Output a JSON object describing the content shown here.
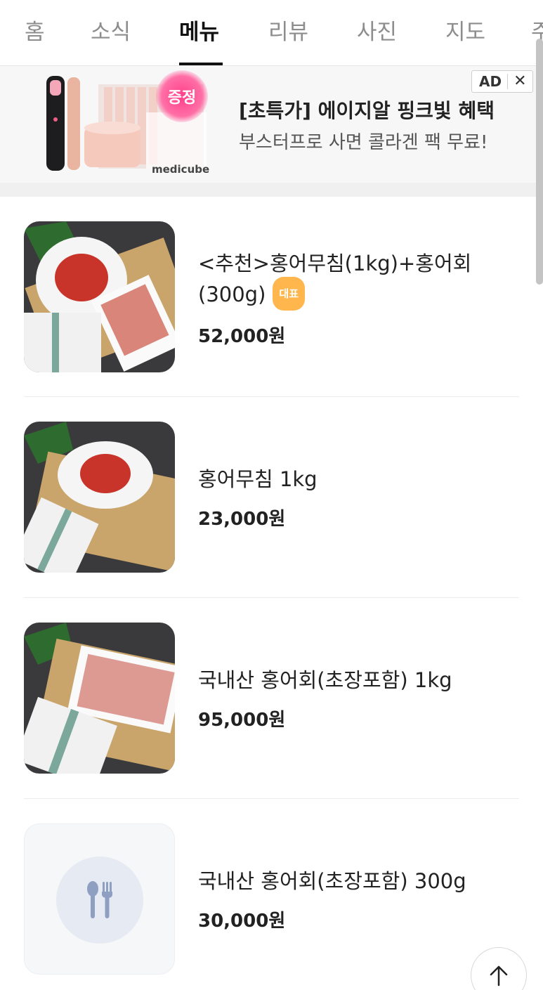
{
  "tabs": [
    {
      "label": "홈"
    },
    {
      "label": "소식"
    },
    {
      "label": "메뉴"
    },
    {
      "label": "리뷰"
    },
    {
      "label": "사진"
    },
    {
      "label": "지도"
    },
    {
      "label": "주"
    }
  ],
  "active_tab": "메뉴",
  "ad": {
    "badge": "AD",
    "close": "✕",
    "title": "[초특가] 에이지알 핑크빛 혜택",
    "subtitle": "부스터프로 사면 콜라겐 팩 무료!",
    "gift_label": "증정",
    "brand": "medicube"
  },
  "menu": {
    "items": [
      {
        "name": "<추천>홍어무침(1kg)+홍어회(300g)",
        "badge": "대표",
        "price": "52,000원"
      },
      {
        "name": "홍어무침 1kg",
        "price": "23,000원"
      },
      {
        "name": "국내산 홍어회(초장포함) 1kg",
        "price": "95,000원"
      },
      {
        "name": "국내산 홍어회(초장포함) 300g",
        "price": "30,000원"
      }
    ]
  },
  "icons": {
    "scroll_top": "arrow-up-icon",
    "placeholder": "utensils-icon",
    "close": "close-icon"
  },
  "colors": {
    "badge": "#ffb64c",
    "tab_active": "#111111",
    "tab_inactive": "#8d8d8d"
  }
}
